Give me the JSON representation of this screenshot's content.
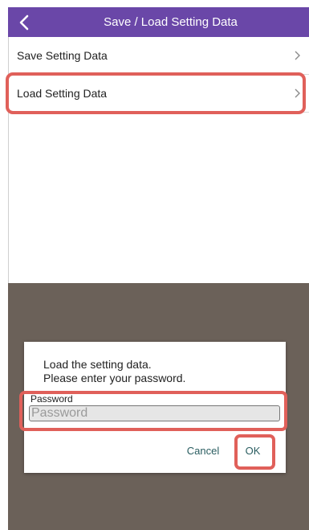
{
  "app_bar": {
    "title": "Save / Load Setting Data",
    "back_icon": "chevron-left-icon",
    "color": "#6a47a8"
  },
  "menu": {
    "items": [
      {
        "label": "Save Setting Data",
        "icon": "chevron-right-icon"
      },
      {
        "label": "Load Setting Data",
        "icon": "chevron-right-icon"
      }
    ]
  },
  "dialog": {
    "message_line1": "Load the setting data.",
    "message_line2": "Please enter your password.",
    "password_label": "Password",
    "password_placeholder": "Password",
    "password_value": "",
    "cancel_label": "Cancel",
    "ok_label": "OK",
    "button_color": "#2a5d60"
  },
  "highlight_color": "#e0605a",
  "overlay_color": "#6b6159"
}
